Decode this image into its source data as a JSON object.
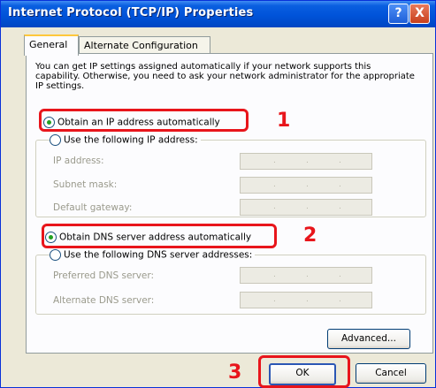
{
  "window": {
    "title": "Internet Protocol (TCP/IP) Properties"
  },
  "titlebar_buttons": {
    "help": "?",
    "close": "X"
  },
  "tabs": [
    {
      "label": "General",
      "selected": true
    },
    {
      "label": "Alternate Configuration",
      "selected": false
    }
  ],
  "intro": "You can get IP settings assigned automatically if your network supports this capability. Otherwise, you need to ask your network administrator for the appropriate IP settings.",
  "ip": {
    "auto_label": "Obtain an IP address automatically",
    "auto_selected": true,
    "manual_label": "Use the following IP address:",
    "fields": [
      {
        "label": "IP address:"
      },
      {
        "label": "Subnet mask:"
      },
      {
        "label": "Default gateway:"
      }
    ]
  },
  "dns": {
    "auto_label": "Obtain DNS server address automatically",
    "auto_selected": true,
    "manual_label": "Use the following DNS server addresses:",
    "fields": [
      {
        "label": "Preferred DNS server:"
      },
      {
        "label": "Alternate DNS server:"
      }
    ]
  },
  "buttons": {
    "advanced": "Advanced...",
    "ok": "OK",
    "cancel": "Cancel"
  },
  "annotations": {
    "step1": "1",
    "step2": "2",
    "step3": "3",
    "color": "#e8151b"
  },
  "icons": {
    "help": "help-icon",
    "close": "close-icon",
    "radio_selected": "radio-selected-icon"
  }
}
